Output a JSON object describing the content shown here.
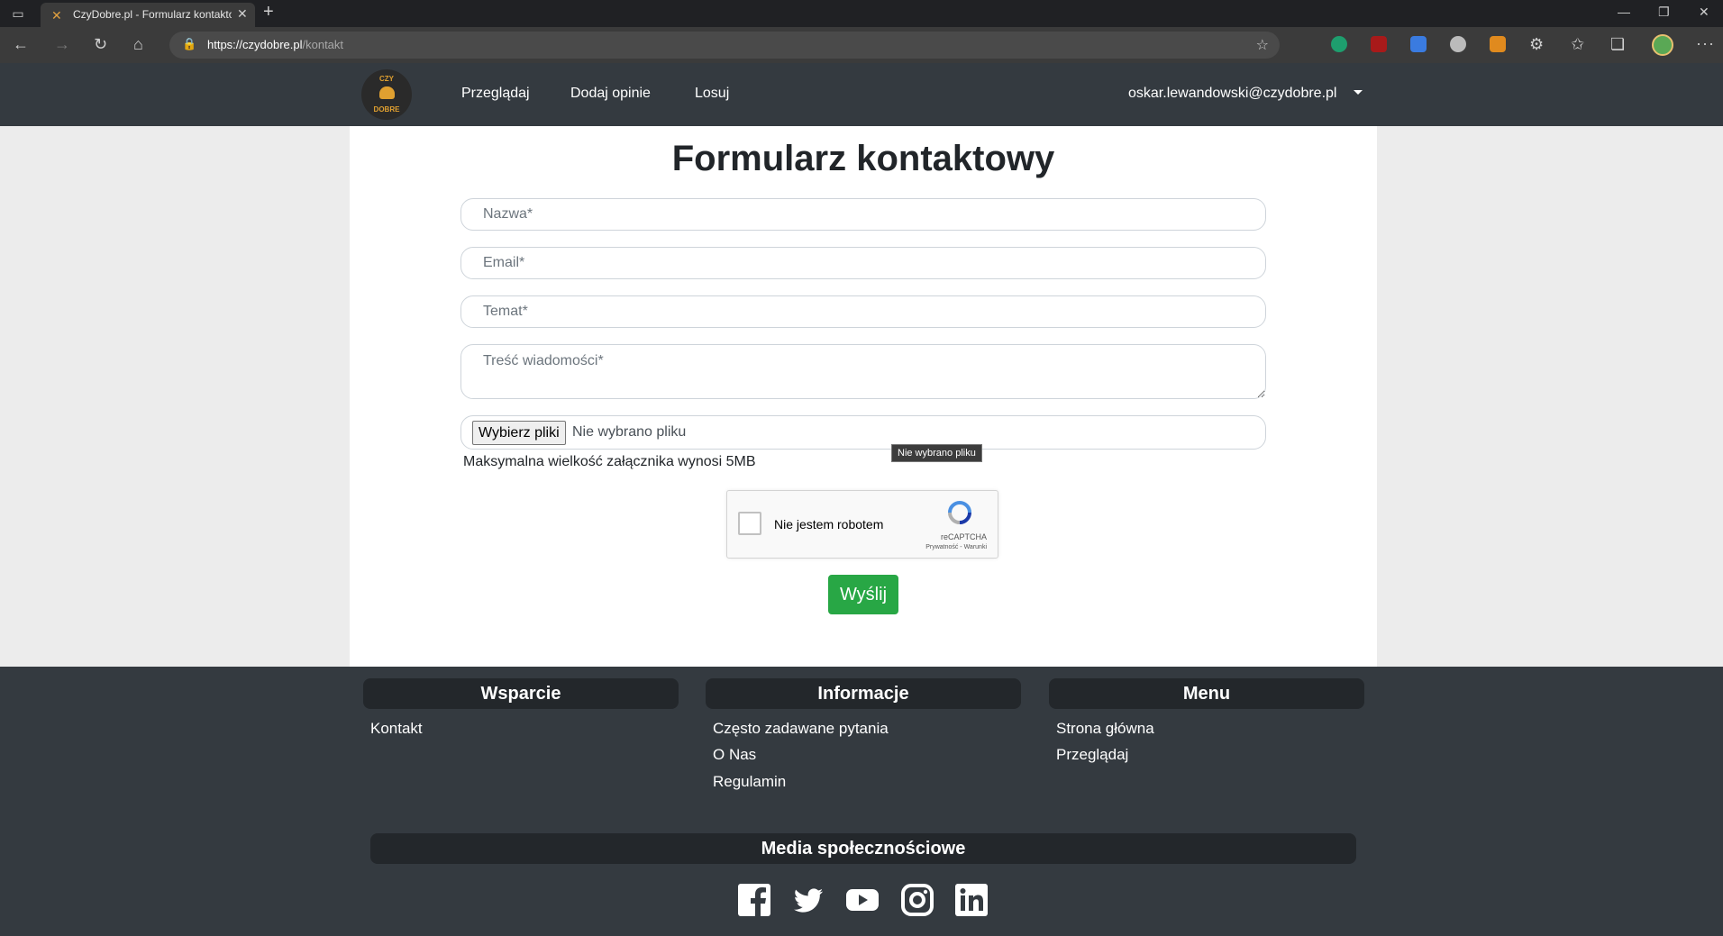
{
  "browser": {
    "tab_title": "CzyDobre.pl - Formularz kontaktowy",
    "url_host": "https://czydobre.pl",
    "url_path": "/kontakt",
    "close_glyph": "✕",
    "new_tab_glyph": "+"
  },
  "header": {
    "logo_top": "CZY",
    "logo_bottom": "DOBRE",
    "nav": [
      "Przeglądaj",
      "Dodaj opinie",
      "Losuj"
    ],
    "user_email": "oskar.lewandowski@czydobre.pl"
  },
  "form": {
    "title": "Formularz kontaktowy",
    "name_placeholder": "Nazwa*",
    "email_placeholder": "Email*",
    "subject_placeholder": "Temat*",
    "message_placeholder": "Treść wiadomości*",
    "file_button": "Wybierz pliki",
    "file_status": "Nie wybrano pliku",
    "file_hint": "Maksymalna wielkość załącznika wynosi 5MB",
    "tooltip": "Nie wybrano pliku",
    "captcha_label": "Nie jestem robotem",
    "captcha_brand": "reCAPTCHA",
    "captcha_links": "Prywatność - Warunki",
    "submit": "Wyślij"
  },
  "footer": {
    "support": {
      "title": "Wsparcie",
      "links": [
        "Kontakt"
      ]
    },
    "info": {
      "title": "Informacje",
      "links": [
        "Często zadawane pytania",
        "O Nas",
        "Regulamin"
      ]
    },
    "menu": {
      "title": "Menu",
      "links": [
        "Strona główna",
        "Przeglądaj"
      ]
    },
    "social": {
      "title": "Media społecznościowe",
      "icons": [
        "facebook-icon",
        "twitter-icon",
        "youtube-icon",
        "instagram-icon",
        "linkedin-icon"
      ]
    }
  },
  "colors": {
    "header_bg": "#343a40",
    "submit_green": "#28a745",
    "page_bg": "#ececec"
  }
}
